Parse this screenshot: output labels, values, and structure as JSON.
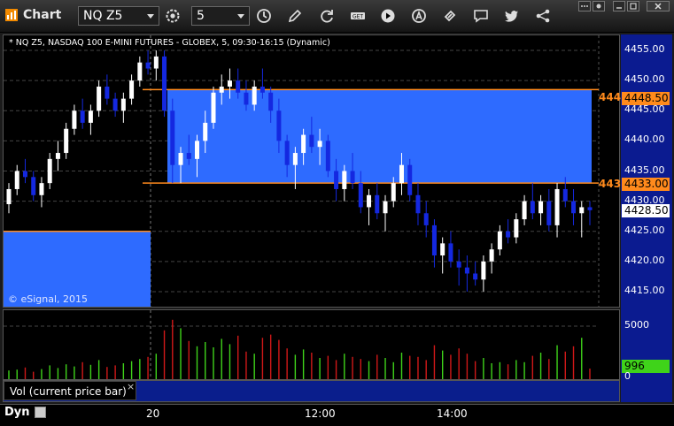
{
  "toolbar": {
    "app_title": "Chart",
    "symbol": "NQ Z5",
    "interval": "5",
    "icons": [
      "settings-gear-icon",
      "clock-icon",
      "pencil-icon",
      "refresh-icon",
      "get-icon",
      "play-icon",
      "alert-icon",
      "link-icon",
      "comment-icon",
      "twitter-icon",
      "share-icon"
    ]
  },
  "price_panel": {
    "title": "* NQ Z5, NASDAQ 100 E-MINI FUTURES - GLOBEX, 5, 09:30-16:15 (Dynamic)",
    "watermark": "© eSignal, 2015",
    "y_ticks": [
      "4455.00",
      "4450.00",
      "4445.00",
      "4440.00",
      "4435.00",
      "4430.00",
      "4425.00",
      "4420.00",
      "4415.00"
    ],
    "y_tick_values": [
      4455,
      4450,
      4445,
      4440,
      4435,
      4430,
      4425,
      4420,
      4415
    ],
    "upper_level": {
      "tag": "4448.50",
      "stub": "444",
      "value": 4448.5
    },
    "lower_level": {
      "tag": "4433.00",
      "stub": "443",
      "value": 4433.0
    },
    "last_price": "4428.50",
    "last_price_value": 4428.5
  },
  "volume_panel": {
    "caption": "Vol (current price bar)",
    "close_glyph": "×",
    "y_ticks": [
      "5000",
      "0"
    ],
    "last_volume": "996"
  },
  "time_axis": {
    "mode": "Dyn",
    "labels": [
      "20",
      "12:00",
      "14:00"
    ]
  },
  "colors": {
    "zone_fill": "#2e6bff",
    "level_line": "#ff8a1c",
    "up_candle": "#ffffff",
    "down_candle": "#1428e0",
    "vol_up": "#3fd31a",
    "vol_down": "#d01818"
  },
  "chart_data": {
    "type": "candlestick",
    "interval_minutes": 5,
    "ohlc": [
      [
        4429.5,
        4433,
        4428,
        4432
      ],
      [
        4432,
        4436,
        4431,
        4435
      ],
      [
        4435,
        4437,
        4433,
        4434
      ],
      [
        4434,
        4435,
        4430,
        4431
      ],
      [
        4431,
        4434,
        4429,
        4433
      ],
      [
        4433,
        4438,
        4432,
        4437
      ],
      [
        4437,
        4440,
        4435,
        4438
      ],
      [
        4438,
        4443,
        4437,
        4442
      ],
      [
        4442,
        4446,
        4441,
        4445
      ],
      [
        4445,
        4447,
        4442,
        4443
      ],
      [
        4443,
        4446,
        4441,
        4445
      ],
      [
        4445,
        4450,
        4444,
        4449
      ],
      [
        4449,
        4451,
        4446,
        4447
      ],
      [
        4447,
        4448,
        4444,
        4445
      ],
      [
        4445,
        4448,
        4443,
        4447
      ],
      [
        4447,
        4451,
        4446,
        4450
      ],
      [
        4450,
        4454,
        4449,
        4453
      ],
      [
        4453,
        4455,
        4451,
        4452
      ],
      [
        4452,
        4455,
        4450,
        4454
      ],
      [
        4454,
        4455,
        4444,
        4445
      ],
      [
        4445,
        4447,
        4433,
        4436
      ],
      [
        4436,
        4439,
        4433,
        4438
      ],
      [
        4438,
        4441,
        4436,
        4437
      ],
      [
        4437,
        4441,
        4434,
        4440
      ],
      [
        4440,
        4445,
        4438,
        4443
      ],
      [
        4443,
        4449,
        4442,
        4448
      ],
      [
        4448,
        4451,
        4446,
        4449
      ],
      [
        4449,
        4452,
        4447,
        4450
      ],
      [
        4450,
        4452,
        4447,
        4448
      ],
      [
        4448,
        4450,
        4445,
        4446
      ],
      [
        4446,
        4450,
        4445,
        4449
      ],
      [
        4449,
        4452,
        4447,
        4448
      ],
      [
        4448,
        4449,
        4443,
        4445
      ],
      [
        4445,
        4447,
        4438,
        4440
      ],
      [
        4440,
        4441,
        4434,
        4436
      ],
      [
        4436,
        4439,
        4432,
        4438
      ],
      [
        4438,
        4442,
        4436,
        4441
      ],
      [
        4441,
        4444,
        4438,
        4439
      ],
      [
        4439,
        4442,
        4436,
        4440
      ],
      [
        4440,
        4441,
        4434,
        4435
      ],
      [
        4435,
        4437,
        4430,
        4432
      ],
      [
        4432,
        4436,
        4430,
        4435
      ],
      [
        4435,
        4438,
        4432,
        4433
      ],
      [
        4433,
        4435,
        4428,
        4429
      ],
      [
        4429,
        4432,
        4426,
        4431
      ],
      [
        4431,
        4433,
        4427,
        4428
      ],
      [
        4428,
        4431,
        4425,
        4430
      ],
      [
        4430,
        4434,
        4429,
        4433
      ],
      [
        4433,
        4438,
        4431,
        4436
      ],
      [
        4436,
        4437,
        4430,
        4431
      ],
      [
        4431,
        4433,
        4426,
        4428
      ],
      [
        4428,
        4430,
        4424,
        4426
      ],
      [
        4426,
        4427,
        4419,
        4421
      ],
      [
        4421,
        4424,
        4418,
        4423
      ],
      [
        4423,
        4425,
        4419,
        4420
      ],
      [
        4420,
        4422,
        4416,
        4419
      ],
      [
        4419,
        4421,
        4415,
        4418
      ],
      [
        4418,
        4420,
        4416,
        4417
      ],
      [
        4417,
        4421,
        4415,
        4420
      ],
      [
        4420,
        4423,
        4418,
        4422
      ],
      [
        4422,
        4426,
        4421,
        4425
      ],
      [
        4425,
        4427,
        4423,
        4424
      ],
      [
        4424,
        4428,
        4423,
        4427
      ],
      [
        4427,
        4431,
        4426,
        4430
      ],
      [
        4430,
        4433,
        4427,
        4428
      ],
      [
        4428,
        4431,
        4426,
        4430
      ],
      [
        4430,
        4432,
        4425,
        4426
      ],
      [
        4426,
        4433,
        4424,
        4432
      ],
      [
        4432,
        4434,
        4429,
        4430
      ],
      [
        4430,
        4432,
        4426,
        4428
      ],
      [
        4428,
        4430,
        4424,
        4429
      ],
      [
        4429,
        4430,
        4426,
        4428.5
      ]
    ],
    "volume": [
      820,
      900,
      1100,
      700,
      950,
      1300,
      1050,
      1400,
      1200,
      1600,
      1350,
      1800,
      1150,
      1300,
      1500,
      1700,
      1900,
      2100,
      2400,
      4600,
      5600,
      4800,
      3600,
      3100,
      3500,
      3000,
      3800,
      3300,
      4100,
      2600,
      2400,
      3900,
      4200,
      3700,
      2900,
      2300,
      2800,
      2500,
      2000,
      2200,
      1800,
      2400,
      2100,
      1900,
      1700,
      2300,
      2000,
      1600,
      2500,
      2200,
      2100,
      1800,
      3200,
      2700,
      2300,
      2900,
      2400,
      1700,
      2000,
      1500,
      1600,
      1400,
      1800,
      1600,
      2200,
      2500,
      1900,
      3200,
      2600,
      3100,
      3900,
      996
    ],
    "y_range": [
      4412.5,
      4457.5
    ],
    "volume_range": [
      0,
      6500
    ]
  }
}
